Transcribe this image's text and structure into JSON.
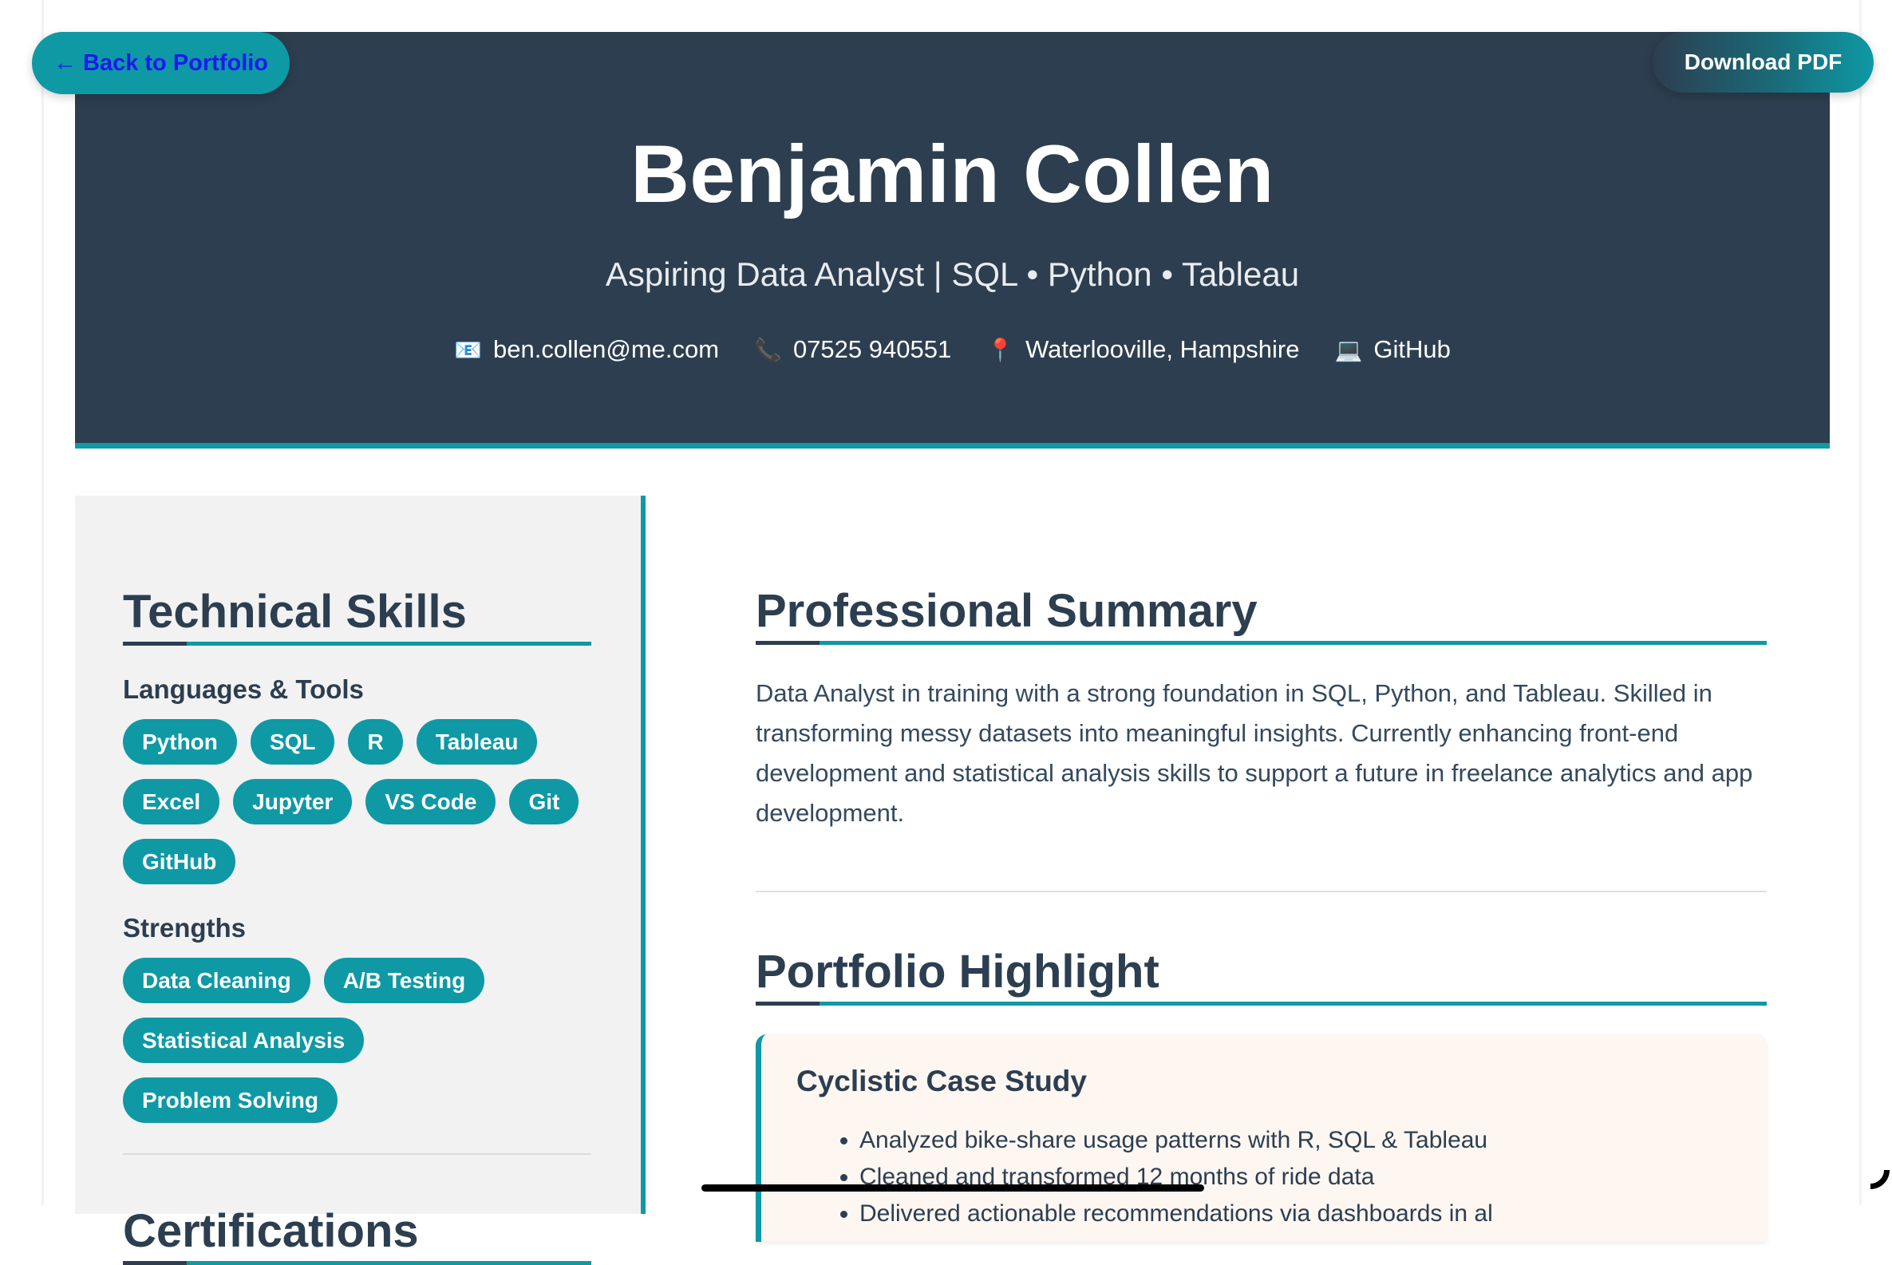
{
  "nav": {
    "back_label": "← Back to Portfolio",
    "download_label": "Download PDF"
  },
  "header": {
    "name": "Benjamin Collen",
    "tagline": "Aspiring Data Analyst | SQL • Python • Tableau",
    "contacts": [
      {
        "icon": "📧",
        "icon_name": "email-icon",
        "text": "ben.collen@me.com"
      },
      {
        "icon": "📞",
        "icon_name": "phone-icon",
        "text": "07525 940551"
      },
      {
        "icon": "📍",
        "icon_name": "location-pin-icon",
        "text": "Waterlooville, Hampshire"
      },
      {
        "icon": "💻",
        "icon_name": "laptop-icon",
        "text": "GitHub"
      }
    ]
  },
  "sidebar": {
    "skills_title": "Technical Skills",
    "languages_title": "Languages & Tools",
    "languages": [
      "Python",
      "SQL",
      "R",
      "Tableau",
      "Excel",
      "Jupyter",
      "VS Code",
      "Git",
      "GitHub"
    ],
    "strengths_title": "Strengths",
    "strengths": [
      "Data Cleaning",
      "A/B Testing",
      "Statistical Analysis",
      "Problem Solving"
    ],
    "certifications_title": "Certifications"
  },
  "main": {
    "summary_title": "Professional Summary",
    "summary_text": "Data Analyst in training with a strong foundation in SQL, Python, and Tableau. Skilled in transforming messy datasets into meaningful insights. Currently enhancing front-end development and statistical analysis skills to support a future in freelance analytics and app development.",
    "highlight_title": "Portfolio Highlight",
    "card": {
      "title": "Cyclistic Case Study",
      "bullets": [
        "Analyzed bike-share usage patterns with R, SQL & Tableau",
        "Cleaned and transformed 12 months of ride data",
        "Delivered actionable recommendations via dashboards in al"
      ]
    }
  },
  "colors": {
    "accent": "#0e99a5",
    "header_bg": "#2d3e50",
    "sidebar_bg": "#f2f2f2",
    "card_bg": "#fdf6f1"
  }
}
